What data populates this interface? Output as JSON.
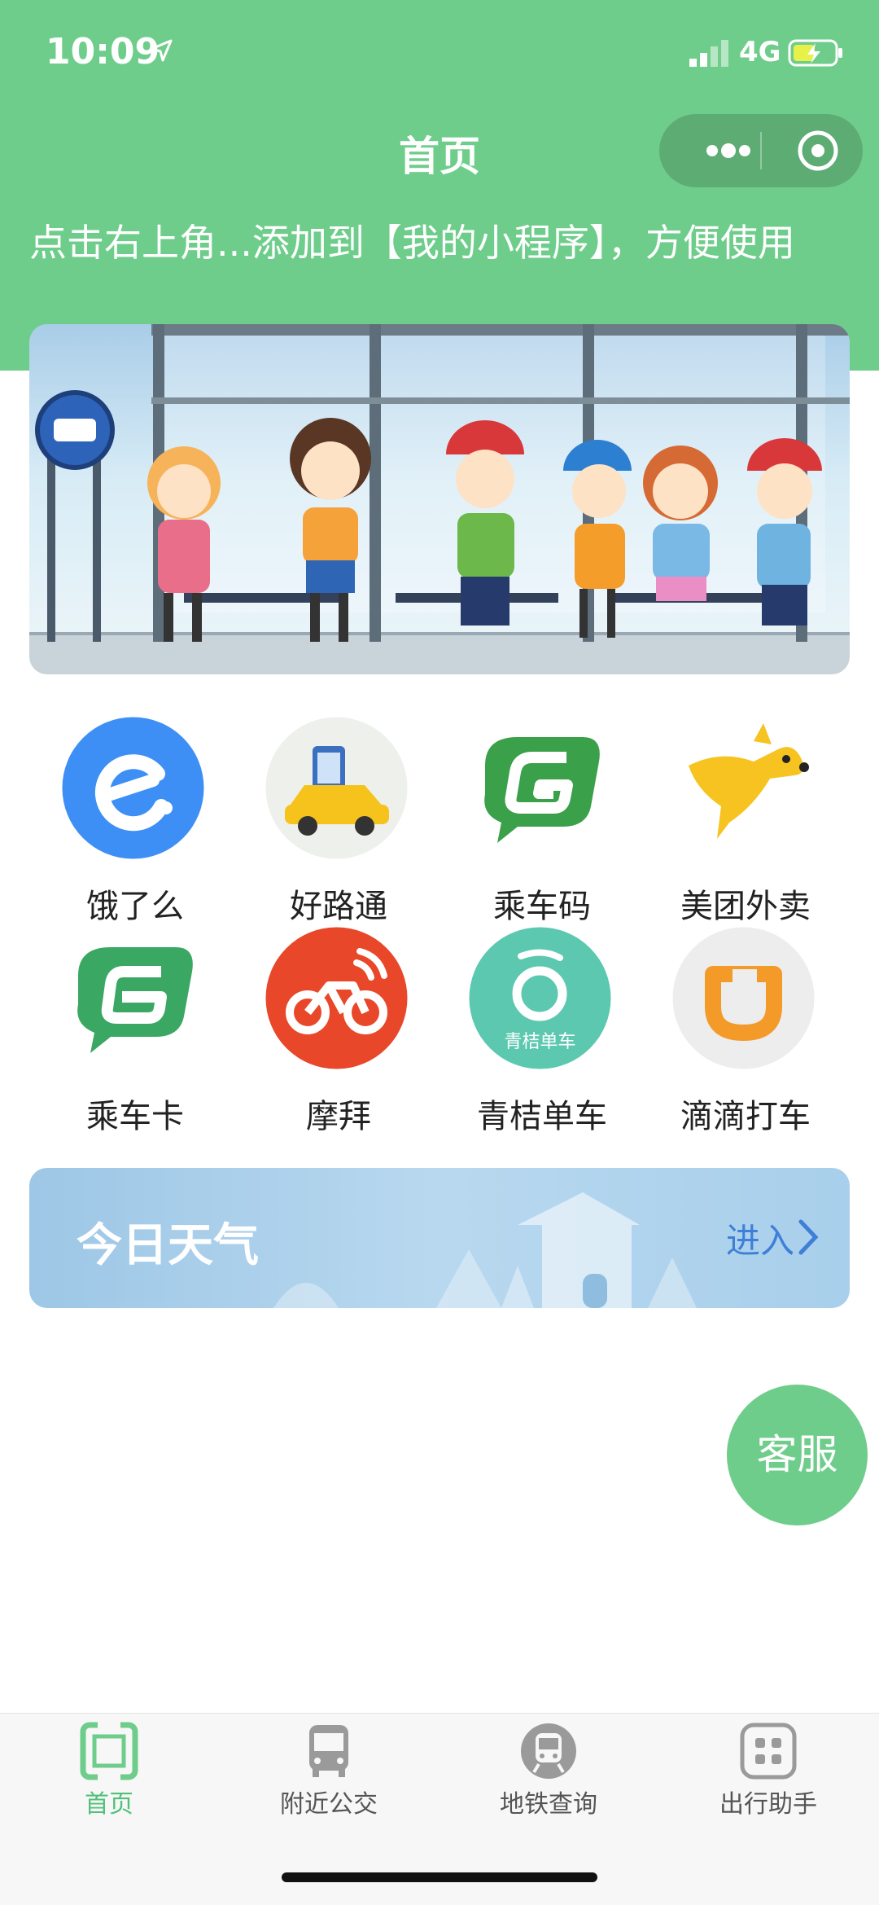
{
  "status_bar": {
    "time": "10:09",
    "network": "4G"
  },
  "nav": {
    "title": "首页"
  },
  "tip": "点击右上角...添加到【我的小程序】，方便使用",
  "apps": [
    {
      "label": "饿了么",
      "icon": "eleme-icon"
    },
    {
      "label": "好路通",
      "icon": "haolutong-icon"
    },
    {
      "label": "乘车码",
      "icon": "ride-code-icon"
    },
    {
      "label": "美团外卖",
      "icon": "meituan-waimai-icon"
    },
    {
      "label": "乘车卡",
      "icon": "ride-card-icon"
    },
    {
      "label": "摩拜",
      "icon": "mobike-icon"
    },
    {
      "label": "青桔单车",
      "icon": "qingju-bike-icon"
    },
    {
      "label": "滴滴打车",
      "icon": "didi-icon"
    }
  ],
  "qingju_badge": "青桔单车",
  "weather": {
    "title": "今日天气",
    "enter": "进入"
  },
  "customer_service": "客服",
  "tabs": [
    {
      "label": "首页",
      "icon": "home-scan-icon",
      "active": true
    },
    {
      "label": "附近公交",
      "icon": "bus-icon",
      "active": false
    },
    {
      "label": "地铁查询",
      "icon": "metro-icon",
      "active": false
    },
    {
      "label": "出行助手",
      "icon": "grid-apps-icon",
      "active": false
    }
  ],
  "colors": {
    "brand_green": "#6fcd8b",
    "tab_active": "#4fc17a",
    "weather_link": "#3e7fd8"
  }
}
